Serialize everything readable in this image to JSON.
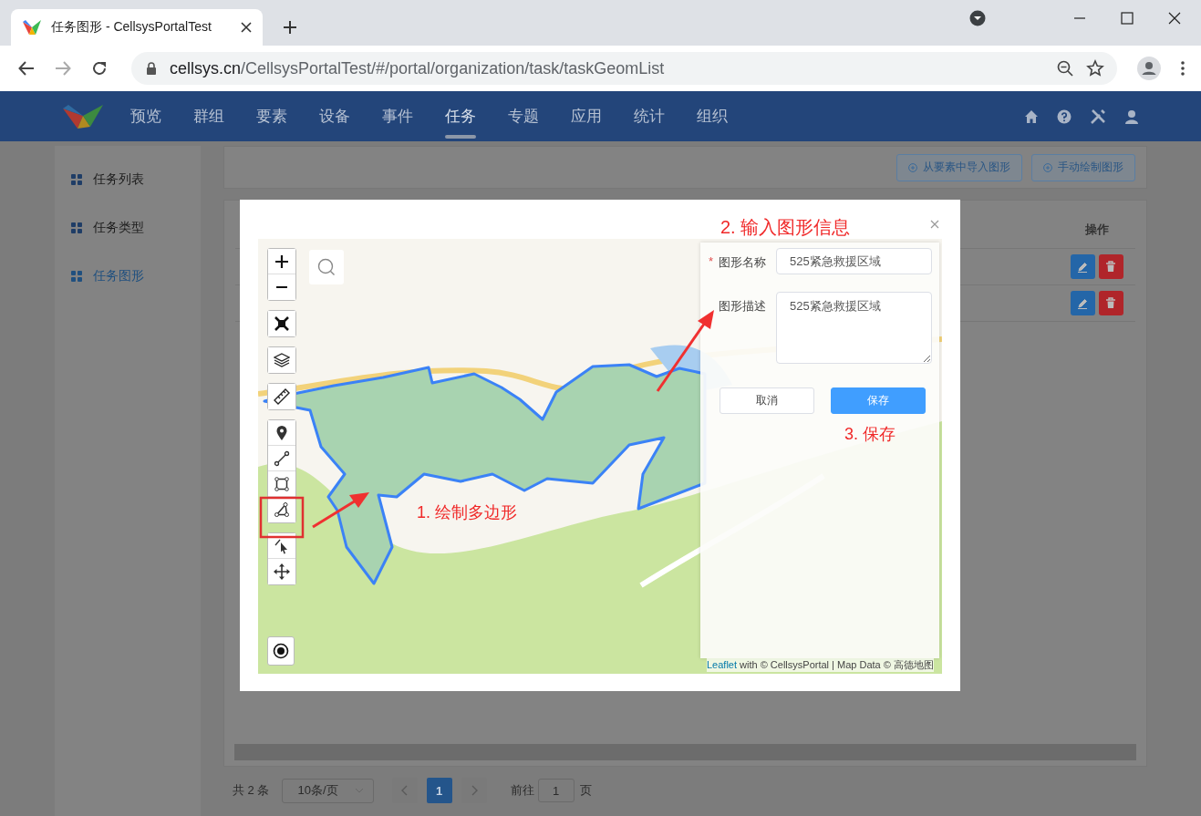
{
  "browser": {
    "tab_title": "任务图形 - CellsysPortalTest",
    "url_host": "cellsys.cn",
    "url_path": "/CellsysPortalTest/#/portal/organization/task/taskGeomList"
  },
  "nav": {
    "items": [
      {
        "label": "预览",
        "selected": false
      },
      {
        "label": "群组",
        "selected": false
      },
      {
        "label": "要素",
        "selected": false
      },
      {
        "label": "设备",
        "selected": false
      },
      {
        "label": "事件",
        "selected": false
      },
      {
        "label": "任务",
        "selected": true
      },
      {
        "label": "专题",
        "selected": false
      },
      {
        "label": "应用",
        "selected": false
      },
      {
        "label": "统计",
        "selected": false
      },
      {
        "label": "组织",
        "selected": false
      }
    ]
  },
  "sidebar": {
    "items": [
      {
        "label": "任务列表",
        "selected": false
      },
      {
        "label": "任务类型",
        "selected": false
      },
      {
        "label": "任务图形",
        "selected": true
      }
    ]
  },
  "toolbar": {
    "buttons": [
      "从要素中导入图形",
      "手动绘制图形"
    ]
  },
  "table": {
    "columns": [
      {
        "label": "操作"
      }
    ],
    "rows": [
      {
        "actions": [
          {
            "kind": "edit"
          },
          {
            "kind": "delete"
          }
        ]
      },
      {
        "actions": [
          {
            "kind": "edit"
          },
          {
            "kind": "delete"
          }
        ]
      }
    ]
  },
  "pagination": {
    "total": "共 2 条",
    "page_size": "10条/页",
    "pages": [
      {
        "label": "1",
        "selected": true
      }
    ],
    "goto_label": "前往",
    "goto_value": "1",
    "goto_suffix": "页"
  },
  "modal": {
    "map_tools": [
      {
        "kind": "marker"
      },
      {
        "kind": "line"
      },
      {
        "kind": "rectangle"
      },
      {
        "kind": "polygon"
      }
    ],
    "fields": [
      {
        "kind": "input",
        "label": "图形名称",
        "required_mark": "*",
        "value": "525紧急救援区域"
      },
      {
        "kind": "textarea",
        "label": "图形描述",
        "value": "525紧急救援区域"
      }
    ],
    "buttons": [
      {
        "kind": "default",
        "label": "取消"
      },
      {
        "kind": "primary",
        "label": "保存"
      }
    ],
    "annotations": [
      "1. 绘制多边形",
      "2. 输入图形信息",
      "3. 保存"
    ],
    "attribution": {
      "link": "Leaflet",
      "text": "with © CellsysPortal | Map Data © 高德地图"
    }
  }
}
